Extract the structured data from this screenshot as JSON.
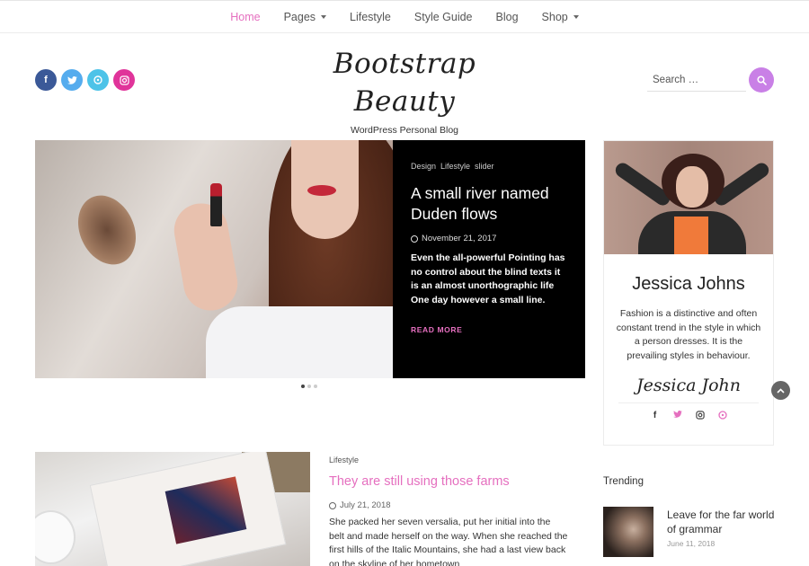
{
  "nav": {
    "items": [
      {
        "label": "Home",
        "active": true,
        "has_dropdown": false
      },
      {
        "label": "Pages",
        "active": false,
        "has_dropdown": true
      },
      {
        "label": "Lifestyle",
        "active": false,
        "has_dropdown": false
      },
      {
        "label": "Style Guide",
        "active": false,
        "has_dropdown": false
      },
      {
        "label": "Blog",
        "active": false,
        "has_dropdown": false
      },
      {
        "label": "Shop",
        "active": false,
        "has_dropdown": true
      }
    ]
  },
  "header": {
    "site_title": "Bootstrap Beauty",
    "tagline": "WordPress Personal Blog",
    "social": [
      "facebook-icon",
      "twitter-icon",
      "pinterest-icon",
      "instagram-icon"
    ],
    "search_placeholder": "Search …"
  },
  "slider": {
    "categories": [
      "Design",
      "Lifestyle",
      "slider"
    ],
    "title": "A small river named Duden flows",
    "date": "November 21, 2017",
    "excerpt": "Even the all-powerful Pointing has no control about the blind texts it is an almost unorthographic life One day however a small line.",
    "read_more": "READ MORE",
    "dots_total": 3,
    "dots_active": 1
  },
  "author": {
    "name": "Jessica Johns",
    "bio": "Fashion is a distinctive and often constant trend in the style in which a person dresses. It is the prevailing styles in behaviour.",
    "signature": "Jessica John",
    "social": [
      "facebook-icon",
      "twitter-icon",
      "instagram-icon",
      "pinterest-icon"
    ]
  },
  "post": {
    "category": "Lifestyle",
    "title": "They are still using those farms",
    "date": "July 21, 2018",
    "excerpt": "She packed her seven versalia, put her initial into the belt and made herself on the way. When she reached the first hills of the Italic Mountains, she had a last view back on the skyline of her hometown"
  },
  "trending": {
    "heading": "Trending",
    "items": [
      {
        "title": "Leave for the far world of grammar",
        "date": "June 11, 2018"
      }
    ]
  },
  "colors": {
    "accent": "#e56fbf",
    "search_button": "#c980e6",
    "facebook": "#3b5998",
    "twitter": "#55acee",
    "pinterest": "#4dc3e8",
    "instagram": "#e0349a"
  }
}
